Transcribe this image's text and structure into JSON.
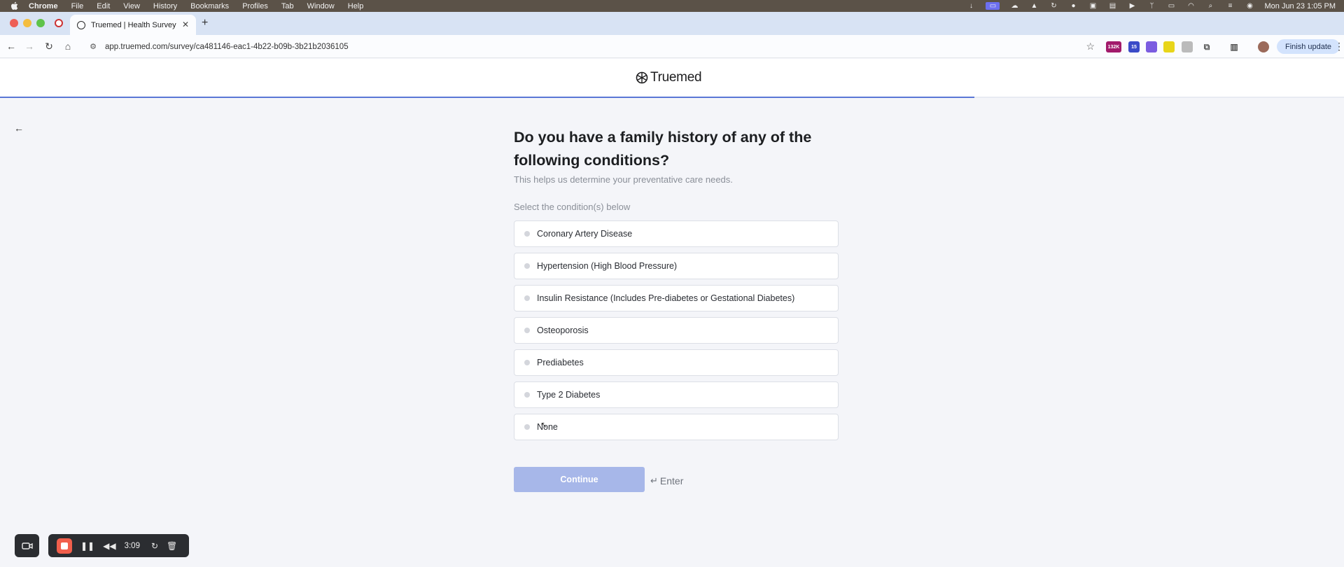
{
  "menubar": {
    "app_name": "Chrome",
    "items": [
      "File",
      "Edit",
      "View",
      "History",
      "Bookmarks",
      "Profiles",
      "Tab",
      "Window",
      "Help"
    ],
    "clock": "Mon Jun 23  1:05 PM"
  },
  "browser": {
    "tab_title": "Truemed | Health Survey",
    "url": "app.truemed.com/survey/ca481146-eac1-4b22-b09b-3b21b2036105",
    "ext_badge_1": "132K",
    "ext_badge_2": "15",
    "finish_update_label": "Finish update"
  },
  "header": {
    "logo_text": "Truemed",
    "progress": 0.725
  },
  "survey": {
    "question": "Do you have a family history of any of the following conditions?",
    "subtitle": "This helps us determine your preventative care needs.",
    "select_label": "Select the condition(s) below",
    "options": [
      "Coronary Artery Disease",
      "Hypertension (High Blood Pressure)",
      "Insulin Resistance (Includes Pre-diabetes or Gestational Diabetes)",
      "Osteoporosis",
      "Prediabetes",
      "Type 2 Diabetes",
      "None"
    ],
    "continue_label": "Continue",
    "enter_hint": "Enter"
  },
  "recorder": {
    "elapsed": "3:09"
  },
  "colors": {
    "accent": "#5a77d6",
    "continue_disabled": "#a7b7e9",
    "page_bg": "#f4f5f9"
  }
}
